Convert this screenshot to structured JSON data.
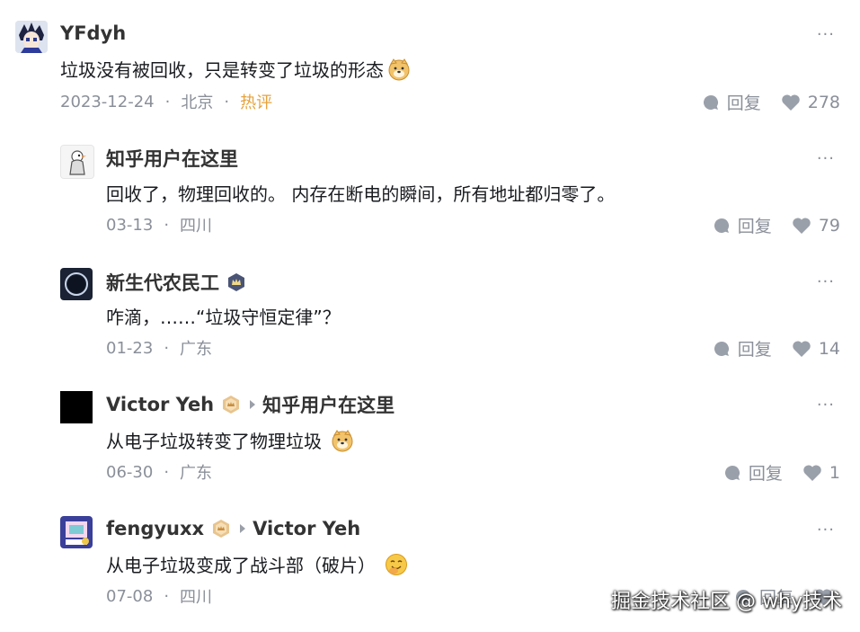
{
  "more_label": "···",
  "comments": [
    {
      "name": "YFdyh",
      "text": "垃圾没有被回收，只是转变了垃圾的形态",
      "date": "2023-12-24",
      "location": "北京",
      "tag": "热评",
      "reply_label": "回复",
      "likes": "278",
      "emoji": "doge-emoji"
    },
    {
      "name": "知乎用户在这里",
      "text": "回收了，物理回收的。 内存在断电的瞬间，所有地址都归零了。",
      "date": "03-13",
      "location": "四川",
      "reply_label": "回复",
      "likes": "79"
    },
    {
      "name": "新生代农民工",
      "badge": "crown-badge-icon",
      "text": "咋滴，……“垃圾守恒定律”？",
      "date": "01-23",
      "location": "广东",
      "reply_label": "回复",
      "likes": "14"
    },
    {
      "name": "Victor Yeh",
      "badge": "gold-badge-icon",
      "reply_to": "知乎用户在这里",
      "text": "从电子垃圾转变了物理垃圾",
      "date": "06-30",
      "location": "广东",
      "reply_label": "回复",
      "likes": "1",
      "emoji": "doge-emoji"
    },
    {
      "name": "fengyuxx",
      "badge": "gold-badge-icon",
      "reply_to": "Victor Yeh",
      "text": "从电子垃圾变成了战斗部（破片）",
      "date": "07-08",
      "location": "四川",
      "reply_label": "回复",
      "likes": "",
      "emoji": "shy-laugh-emoji"
    }
  ],
  "watermark": "掘金技术社区 @ why技术",
  "colors": {
    "hot": "#e6a23c",
    "meta": "#8a8f99",
    "icon": "#9aa0aa"
  }
}
